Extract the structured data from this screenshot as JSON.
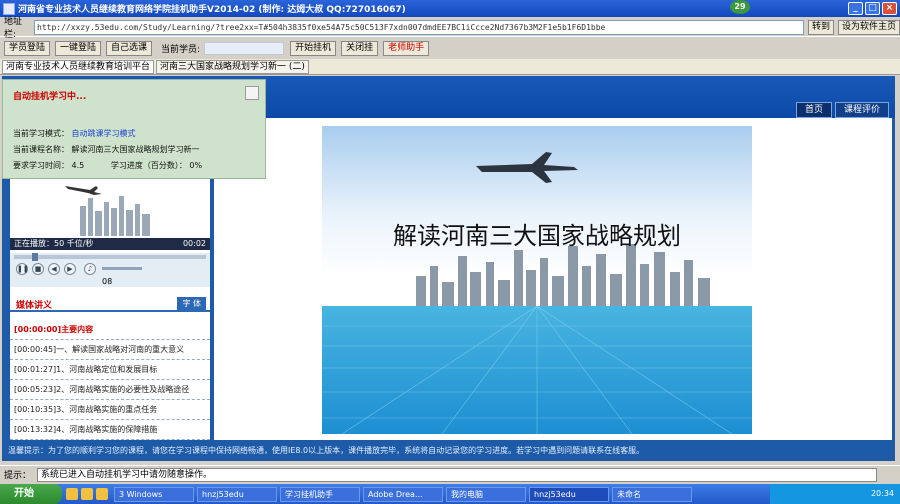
{
  "window": {
    "title": "河南省专业技术人员继续教育网络学院挂机助手V2014-02 (制作: 达姆大叔 QQ:727016067)",
    "badge": "29",
    "min_label": "_",
    "max_label": "□",
    "close_label": "×"
  },
  "address": {
    "label": "地址栏:",
    "url": "http://xxzy.53edu.com/Study/Learning/?tree2xx=T#504h3835f0xe54A75c50C513F7xdn007dmdEE7BC1iCcce2Nd7367b3M2F1e5b1F6D1bbe",
    "go_label": "转到",
    "home_label": "设为软件主页"
  },
  "toolbar": {
    "buttons": [
      "学员登陆",
      "一键登陆",
      "自己选课"
    ],
    "user_label": "当前学员:",
    "btn_start": "开始挂机",
    "btn_stop": "关闭挂",
    "btn_red": "老师助手"
  },
  "tabs": [
    "河南专业技术人员继续教育培训平台",
    "河南三大国家战略规划学习新一 (二)"
  ],
  "popup": {
    "title": "自动挂机学习中...",
    "mode_label": "当前学习模式：",
    "mode_value": "自动跳课学习模式",
    "course_label": "当前课程名称：",
    "course_value": "解读河南三大国家战略规划学习新一",
    "time_label": "要求学习时间：",
    "time_value": "4.5",
    "progress_label": "学习进度（百分数）：",
    "progress_value": "0%"
  },
  "nav": {
    "home": "首页",
    "rating": "课程评价"
  },
  "slide": {
    "title": "解读河南三大国家战略规划"
  },
  "video": {
    "status": "正在播放：50 千位/秒",
    "time": "00:02",
    "counter": "08"
  },
  "lecture": {
    "title": "媒体讲义",
    "button": "字 体",
    "items": [
      "[00:00:00]主要内容",
      "[00:00:45]一、解读国家战略对河南的重大意义",
      "[00:01:27]1、河南战略定位和发展目标",
      "[00:05:23]2、河南战略实施的必要性及战略途径",
      "[00:10:35]3、河南战略实施的重点任务",
      "[00:13:32]4、河南战略实施的保障措施"
    ]
  },
  "footer_text": "温馨提示：为了您的顺利学习您的课程，请您在学习课程中保持网络畅通，使用IE8.0以上版本，课件播放完毕，系统将自动记录您的学习进度。若学习中遇到问题请联系在线客服。",
  "status": {
    "label": "提示：",
    "text": "系统已进入自动挂机学习中请勿随意操作。"
  },
  "taskbar": {
    "start": "开始",
    "tasks": [
      "3 Windows",
      "hnzj53edu",
      "学习挂机助手",
      "Adobe Drea...",
      "我的电脑",
      "hnzj53edu",
      "未命名"
    ],
    "clock": "20:34"
  }
}
